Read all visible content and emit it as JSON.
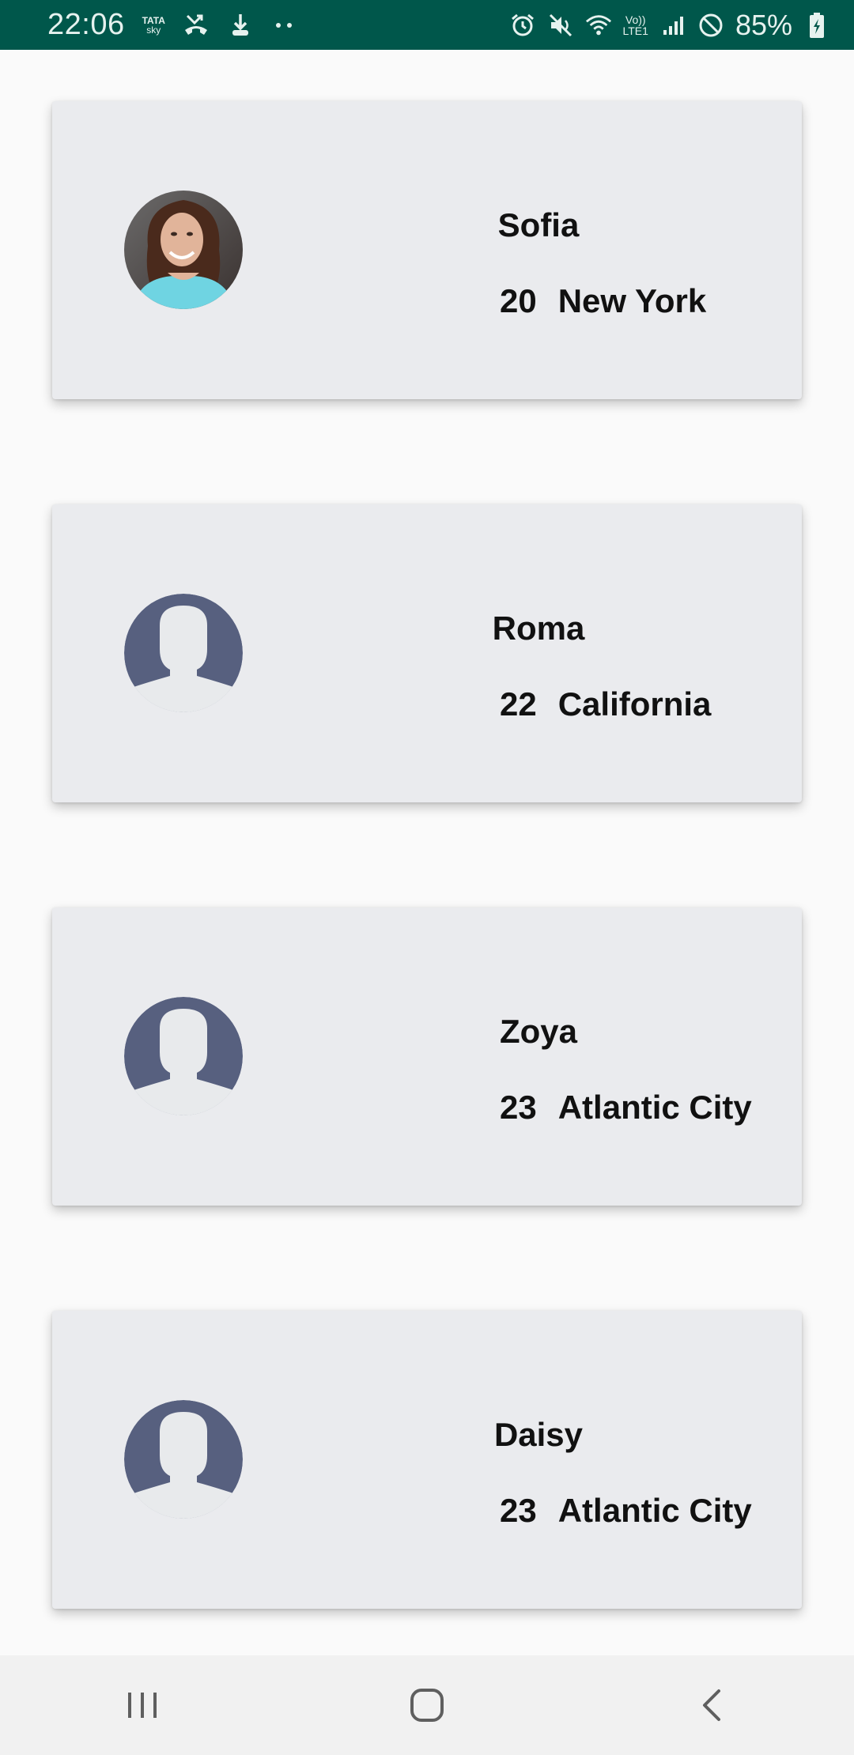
{
  "status_bar": {
    "time": "22:06",
    "carrier_line1": "TATA",
    "carrier_line2": "sky",
    "volte_line1": "Vo))",
    "volte_line2": "LTE1",
    "battery": "85%",
    "icons": [
      "missed-call-icon",
      "download-icon",
      "more-dots-icon",
      "alarm-icon",
      "mute-icon",
      "wifi-icon",
      "signal-icon",
      "do-not-disturb-icon",
      "battery-charging-icon"
    ],
    "background_color": "#00574b"
  },
  "people": [
    {
      "name": "Sofia",
      "age": "20",
      "city": "New York",
      "avatar": "photo-avatar"
    },
    {
      "name": "Roma",
      "age": "22",
      "city": "California",
      "avatar": "default-avatar-icon"
    },
    {
      "name": "Zoya",
      "age": "23",
      "city": "Atlantic City",
      "avatar": "default-avatar-icon"
    },
    {
      "name": "Daisy",
      "age": "23",
      "city": "Atlantic City",
      "avatar": "default-avatar-icon"
    }
  ],
  "nav_bar": {
    "buttons": [
      "recent-apps-icon",
      "home-icon",
      "back-icon"
    ]
  },
  "colors": {
    "card_background": "#eaebee",
    "avatar_placeholder": "#57607f",
    "page_background": "#fafafa"
  }
}
